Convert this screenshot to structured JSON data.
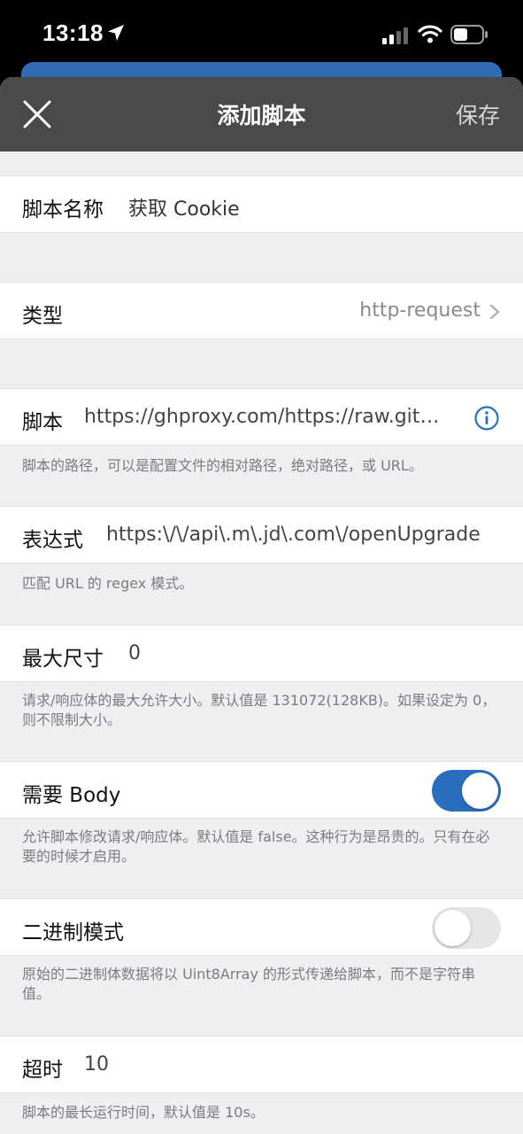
{
  "status_bar": {
    "time": "13:18",
    "icons": [
      "location-arrow-icon",
      "cellular-signal-icon",
      "wifi-icon",
      "battery-icon"
    ]
  },
  "nav": {
    "title": "添加脚本",
    "save_label": "保存",
    "close_icon": "close-icon"
  },
  "form": {
    "name": {
      "label": "脚本名称",
      "value": "获取 Cookie"
    },
    "type": {
      "label": "类型",
      "value": "http-request"
    },
    "script": {
      "label": "脚本",
      "value": "https://ghproxy.com/https://raw.gith...",
      "description": "脚本的路径，可以是配置文件的相对路径，绝对路径，或 URL。"
    },
    "pattern": {
      "label": "表达式",
      "value": "https:\\/\\/api\\.m\\.jd\\.com\\/openUpgrade",
      "description": "匹配 URL 的 regex 模式。"
    },
    "max_size": {
      "label": "最大尺寸",
      "value": "0",
      "description": "请求/响应体的最大允许大小。默认值是 131072(128KB)。如果设定为 0，则不限制大小。"
    },
    "requires_body": {
      "label": "需要 Body",
      "enabled": true,
      "description": "允许脚本修改请求/响应体。默认值是 false。这种行为是昂贵的。只有在必要的时候才启用。"
    },
    "binary_mode": {
      "label": "二进制模式",
      "enabled": false,
      "description": "原始的二进制体数据将以 Uint8Array 的形式传递给脚本，而不是字符串值。"
    },
    "timeout": {
      "label": "超时",
      "value": "10",
      "description": "脚本的最长运行时间，默认值是 10s。"
    }
  },
  "colors": {
    "accent": "#2a6fbd",
    "navbar": "#4a4a4a",
    "background": "#efeff1"
  }
}
